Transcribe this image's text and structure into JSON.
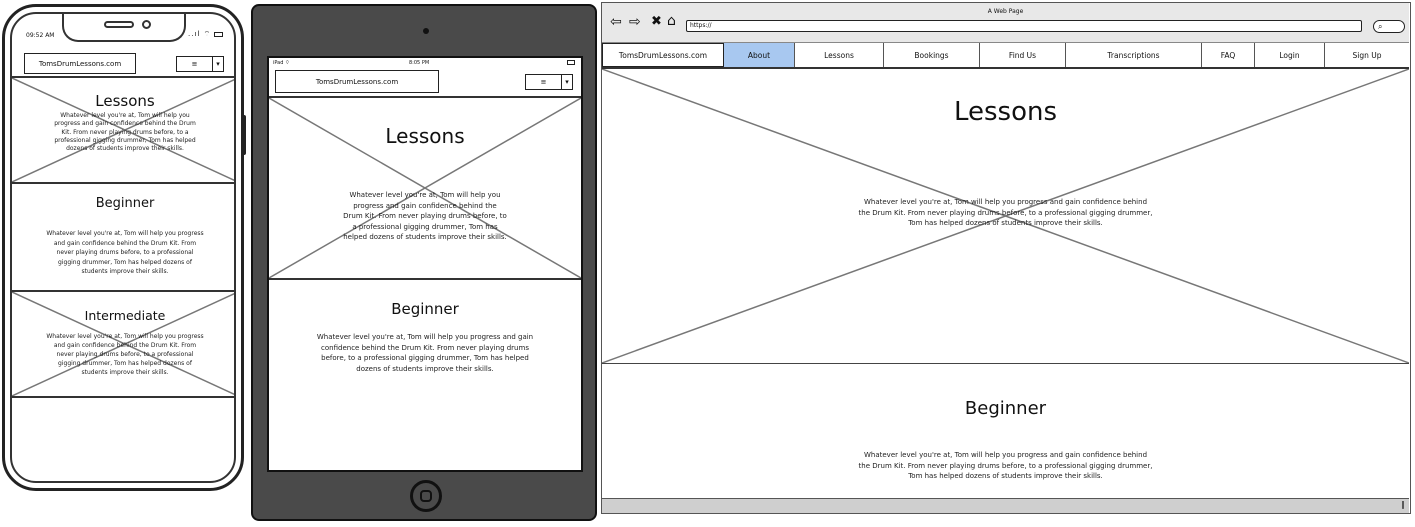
{
  "phone": {
    "time": "09:52 AM",
    "signal": "..ıl",
    "logo": "TomsDrumLessons.com",
    "menu_button": "≡",
    "menu_arrow": "▾",
    "sections": [
      {
        "title": "Lessons",
        "body": "Whatever level you're at, Tom will help you progress and gain confidence behind the Drum Kit. From never playing drums before, to a professional gigging drummer, Tom has helped dozens of students improve their skills."
      },
      {
        "title": "Beginner",
        "body": "Whatever level you're at, Tom will help you progress and gain confidence behind the Drum Kit. From never playing drums before, to a professional gigging drummer, Tom has helped dozens of students improve their skills."
      },
      {
        "title": "Intermediate",
        "body": "Whatever level you're at, Tom will help you progress and gain confidence behind the Drum Kit. From never playing drums before, to a professional gigging drummer, Tom has helped dozens of students improve their skills."
      }
    ]
  },
  "tablet": {
    "carrier": "iPad",
    "time": "8:05 PM",
    "logo": "TomsDrumLessons.com",
    "menu_button": "≡",
    "menu_arrow": "▾",
    "sections": [
      {
        "title": "Lessons",
        "body": "Whatever level you're at, Tom will help you progress and gain confidence behind the Drum Kit. From never playing drums before, to a professional gigging drummer, Tom has helped dozens of students improve their skills."
      },
      {
        "title": "Beginner",
        "body": "Whatever level you're at, Tom will help you progress and gain confidence behind the Drum Kit. From never playing drums before, to a professional gigging drummer, Tom has helped dozens of students improve their skills."
      }
    ]
  },
  "browser": {
    "window_title": "A Web Page",
    "url": "https://",
    "nav": [
      "TomsDrumLessons.com",
      "About",
      "Lessons",
      "Bookings",
      "Find Us",
      "Transcriptions",
      "FAQ",
      "Login",
      "Sign Up"
    ],
    "active_nav": "About",
    "accent": "#a8c8f0",
    "sections": [
      {
        "title": "Lessons",
        "body": "Whatever level you're at, Tom will help you progress and gain confidence behind the Drum Kit. From never playing drums before, to a professional gigging drummer, Tom has helped dozens of students improve their skills."
      },
      {
        "title": "Beginner",
        "body": "Whatever level you're at, Tom will help you progress and gain confidence behind the Drum Kit. From never playing drums before, to a professional gigging drummer, Tom has helped dozens of students improve their skills."
      }
    ]
  }
}
